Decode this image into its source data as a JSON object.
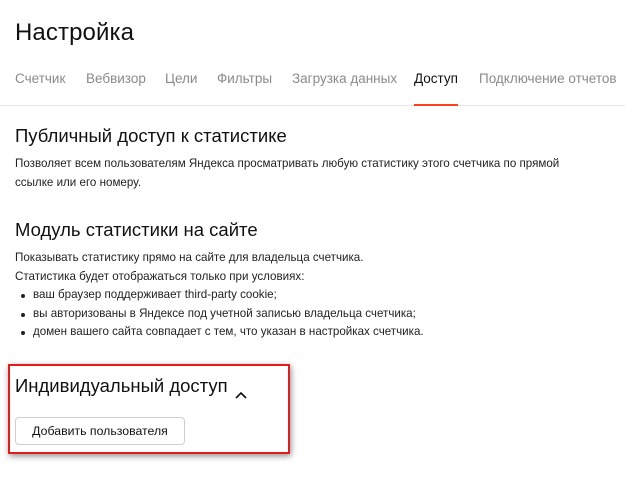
{
  "page_title": "Настройка",
  "tabs": [
    {
      "label": "Счетчик",
      "active": false
    },
    {
      "label": "Вебвизор",
      "active": false
    },
    {
      "label": "Цели",
      "active": false
    },
    {
      "label": "Фильтры",
      "active": false
    },
    {
      "label": "Загрузка данных",
      "active": false
    },
    {
      "label": "Доступ",
      "active": true
    },
    {
      "label": "Подключение отчетов",
      "active": false
    }
  ],
  "public_access": {
    "title": "Публичный доступ к статистике",
    "description_line1": "Позволяет всем пользователям Яндекса просматривать любую статистику этого счетчика по прямой",
    "description_line2": "ссылке или его номеру."
  },
  "stats_module": {
    "title": "Модуль статистики на сайте",
    "line1": "Показывать статистику прямо на сайте для владельца счетчика.",
    "line2": "Статистика будет отображаться только при условиях:",
    "conditions": [
      "ваш браузер поддерживает third-party cookie;",
      "вы авторизованы в Яндексе под учетной записью владельца счетчика;",
      "домен вашего сайта совпадает с тем, что указан в настройках счетчика."
    ]
  },
  "individual_access": {
    "title": "Индивидуальный доступ",
    "toggle_icon": "chevron-up-icon",
    "add_user_label": "Добавить пользователя"
  },
  "colors": {
    "accent_tab_underline": "#fc3f1d",
    "highlight_border": "#e21b1b",
    "inactive_tab_text": "#8a8a8a"
  }
}
